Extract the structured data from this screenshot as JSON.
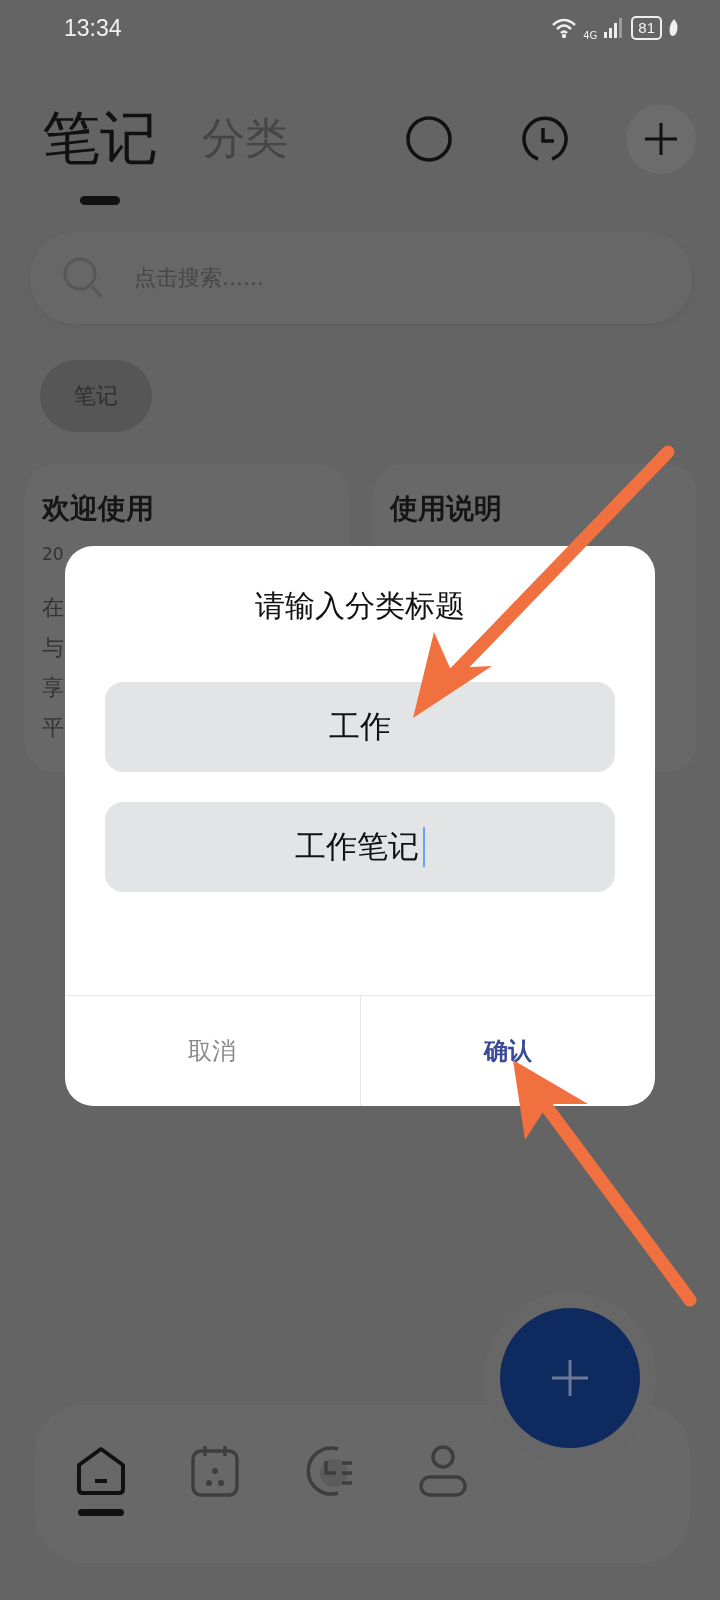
{
  "status_bar": {
    "time": "13:34",
    "network": "4G",
    "battery": "81"
  },
  "tabs": [
    {
      "label": "笔记",
      "selected": true
    },
    {
      "label": "分类",
      "selected": false
    }
  ],
  "search": {
    "placeholder": "点击搜索......"
  },
  "chips": [
    {
      "label": "笔记",
      "selected": true
    }
  ],
  "cards": [
    {
      "title": "欢迎使用",
      "date": "20",
      "lines": [
        "在",
        "与",
        "享",
        "平"
      ]
    },
    {
      "title": "使用说明"
    }
  ],
  "dialog": {
    "title": "请输入分类标题",
    "fields": [
      {
        "value": "工作",
        "focused": false
      },
      {
        "value": "工作笔记",
        "focused": true
      }
    ],
    "buttons": [
      {
        "label": "取消",
        "primary": false
      },
      {
        "label": "确认",
        "primary": true
      }
    ]
  },
  "nav": [
    {
      "kind": "home",
      "selected": true
    },
    {
      "kind": "calendar",
      "selected": false
    },
    {
      "kind": "chart",
      "selected": false
    },
    {
      "kind": "profile",
      "selected": false
    }
  ]
}
